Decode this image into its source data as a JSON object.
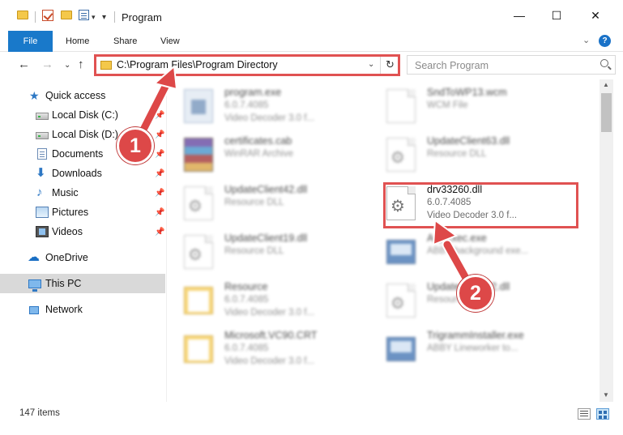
{
  "window": {
    "title": "Program",
    "minimize_glyph": "—",
    "maximize_glyph": "☐",
    "close_glyph": "✕"
  },
  "ribbon": {
    "tabs": [
      "File",
      "Home",
      "Share",
      "View"
    ],
    "help_glyph": "?",
    "expand_glyph": "⌄"
  },
  "nav": {
    "back_glyph": "←",
    "forward_glyph": "→",
    "recent_glyph": "⌄",
    "up_glyph": "↑",
    "address": "C:\\Program Files\\Program Directory",
    "address_dropdown_glyph": "⌄",
    "refresh_glyph": "↻",
    "search_placeholder": "Search Program"
  },
  "sidebar": {
    "items": [
      {
        "label": "Quick access",
        "icon": "star-icon",
        "pinned": false
      },
      {
        "label": "Local Disk (C:)",
        "icon": "local-disk-icon",
        "pinned": true
      },
      {
        "label": "Local Disk (D:)",
        "icon": "local-disk-icon",
        "pinned": true
      },
      {
        "label": "Documents",
        "icon": "documents-icon",
        "pinned": true
      },
      {
        "label": "Downloads",
        "icon": "downloads-icon",
        "pinned": true
      },
      {
        "label": "Music",
        "icon": "music-icon",
        "pinned": true
      },
      {
        "label": "Pictures",
        "icon": "pictures-icon",
        "pinned": true
      },
      {
        "label": "Videos",
        "icon": "videos-icon",
        "pinned": true
      },
      {
        "label": "OneDrive",
        "icon": "onedrive-icon",
        "pinned": false
      },
      {
        "label": "This PC",
        "icon": "this-pc-icon",
        "pinned": false,
        "selected": true
      },
      {
        "label": "Network",
        "icon": "network-icon",
        "pinned": false
      }
    ],
    "pin_glyph": "📌"
  },
  "files": [
    {
      "name": "program.exe",
      "line1": "6.0.7.4085",
      "line2": "Video Decoder 3.0 f...",
      "icon": "exe-icon",
      "blurred": true
    },
    {
      "name": "SndToWP13.wcm",
      "line1": "WCM File",
      "line2": "",
      "icon": "blank-file-icon",
      "blurred": true
    },
    {
      "name": "certificates.cab",
      "line1": "WinRAR Archive",
      "line2": "",
      "icon": "winrar-icon",
      "blurred": true
    },
    {
      "name": "UpdateClient63.dll",
      "line1": "Resource DLL",
      "line2": "",
      "icon": "dll-gear-icon",
      "blurred": true
    },
    {
      "name": "UpdateClient42.dll",
      "line1": "Resource DLL",
      "line2": "",
      "icon": "dll-gear-icon",
      "blurred": true
    },
    {
      "name": "drv33260.dll",
      "line1": "6.0.7.4085",
      "line2": "Video Decoder 3.0 f...",
      "icon": "dll-gear-icon",
      "blurred": false
    },
    {
      "name": "UpdateClient19.dll",
      "line1": "Resource DLL",
      "line2": "",
      "icon": "dll-gear-icon",
      "blurred": true
    },
    {
      "name": "AppExec.exe",
      "line1": "ABBY background exe...",
      "line2": "",
      "icon": "app-icon",
      "blurred": true
    },
    {
      "name": "Resource",
      "line1": "6.0.7.4085",
      "line2": "Video Decoder 3.0 f...",
      "icon": "folder-icon",
      "blurred": true
    },
    {
      "name": "UpdateClient42.dll",
      "line1": "Resource DLL",
      "line2": "",
      "icon": "dll-gear-icon",
      "blurred": true
    },
    {
      "name": "Microsoft.VC90.CRT",
      "line1": "6.0.7.4085",
      "line2": "Video Decoder 3.0 f...",
      "icon": "folder-icon",
      "blurred": true
    },
    {
      "name": "TrigrammInstaller.exe",
      "line1": "ABBY Lineworker to...",
      "line2": "",
      "icon": "app-icon",
      "blurred": true
    }
  ],
  "status": {
    "item_count": "147 items"
  },
  "annotations": {
    "step1": "1",
    "step2": "2"
  },
  "colors": {
    "accent": "#1979ca",
    "highlight": "#e05252",
    "badge": "#dd4848"
  }
}
